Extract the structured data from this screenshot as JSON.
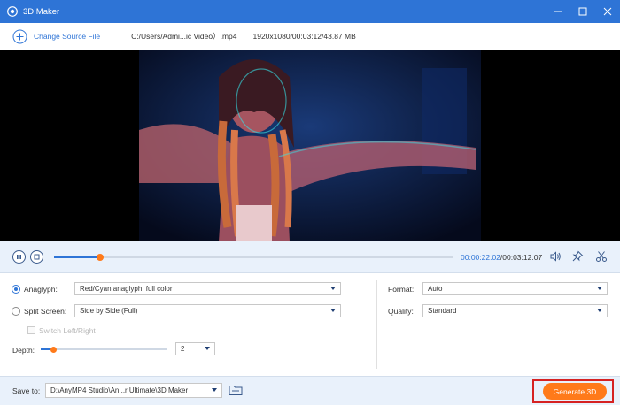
{
  "window": {
    "title": "3D Maker",
    "icon": "app-logo-icon",
    "controls": [
      "minimize-icon",
      "maximize-icon",
      "close-icon"
    ]
  },
  "source": {
    "change_label": "Change Source File",
    "path": "C:/Users/Admi...ic Video）.mp4",
    "meta": "1920x1080/00:03:12/43.87 MB"
  },
  "player": {
    "current_time": "00:00:22.02",
    "total_time": "/00:03:12.07",
    "progress": 0.115,
    "icons": [
      "pause-icon",
      "stop-icon",
      "volume-icon",
      "pin-icon",
      "scissors-icon"
    ]
  },
  "settings": {
    "anaglyph": {
      "label": "Anaglyph:",
      "value": "Red/Cyan anaglyph, full color",
      "selected": true
    },
    "split_screen": {
      "label": "Split Screen:",
      "value": "Side by Side (Full)",
      "selected": false
    },
    "switch_lr": {
      "label": "Switch Left/Right",
      "checked": false,
      "disabled": true
    },
    "depth": {
      "label": "Depth:",
      "value": "2",
      "level": 0.1
    },
    "format": {
      "label": "Format:",
      "value": "Auto"
    },
    "quality": {
      "label": "Quality:",
      "value": "Standard"
    }
  },
  "footer": {
    "save_label": "Save to:",
    "save_path": "D:\\AnyMP4 Studio\\An...r Ultimate\\3D Maker",
    "generate_label": "Generate 3D"
  },
  "colors": {
    "accent": "#2e74d6",
    "action": "#ff7a1a",
    "highlight": "#d62222"
  }
}
